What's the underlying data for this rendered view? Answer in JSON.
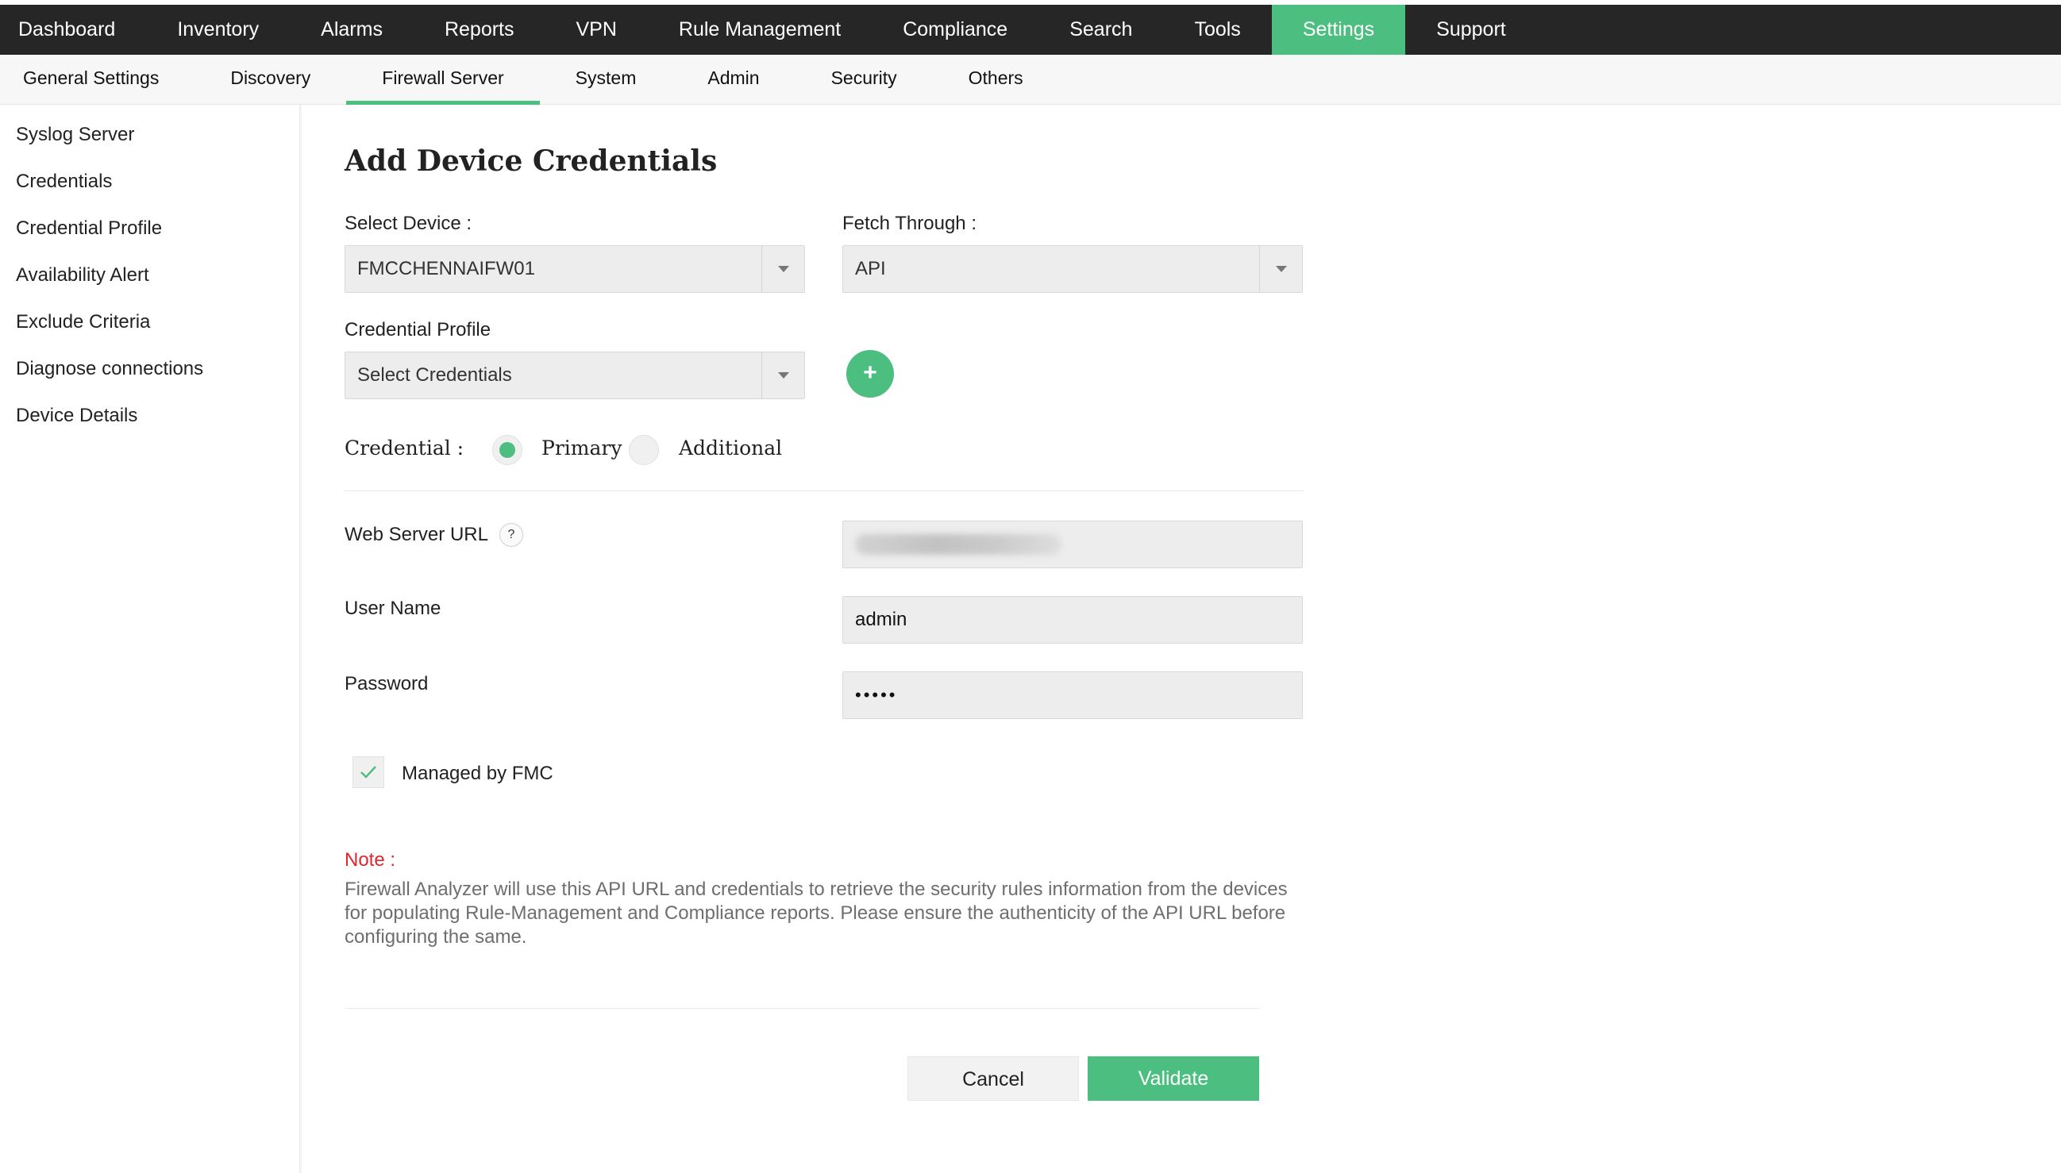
{
  "top_nav": {
    "tabs": [
      {
        "label": "Dashboard"
      },
      {
        "label": "Inventory"
      },
      {
        "label": "Alarms"
      },
      {
        "label": "Reports"
      },
      {
        "label": "VPN"
      },
      {
        "label": "Rule Management"
      },
      {
        "label": "Compliance"
      },
      {
        "label": "Search"
      },
      {
        "label": "Tools"
      },
      {
        "label": "Settings",
        "active": true
      },
      {
        "label": "Support"
      }
    ]
  },
  "sub_nav": {
    "tabs": [
      {
        "label": "General Settings"
      },
      {
        "label": "Discovery"
      },
      {
        "label": "Firewall Server",
        "active": true
      },
      {
        "label": "System"
      },
      {
        "label": "Admin"
      },
      {
        "label": "Security"
      },
      {
        "label": "Others"
      }
    ]
  },
  "sidebar": {
    "items": [
      {
        "label": "Syslog Server"
      },
      {
        "label": "Credentials"
      },
      {
        "label": "Credential Profile"
      },
      {
        "label": "Availability Alert"
      },
      {
        "label": "Exclude Criteria"
      },
      {
        "label": "Diagnose connections"
      },
      {
        "label": "Device Details"
      }
    ]
  },
  "form": {
    "title": "Add Device Credentials",
    "select_device": {
      "label": "Select Device :",
      "value": "FMCCHENNAIFW01"
    },
    "fetch_through": {
      "label": "Fetch Through :",
      "value": "API"
    },
    "credential_profile": {
      "label": "Credential Profile",
      "value": "Select Credentials",
      "add_label": "+"
    },
    "credential": {
      "label": "Credential :",
      "primary_label": "Primary",
      "additional_label": "Additional",
      "selected": "Primary"
    },
    "web_server_url": {
      "label": "Web Server URL",
      "help": "?",
      "value_redacted": true
    },
    "user_name": {
      "label": "User Name",
      "value": "admin"
    },
    "password": {
      "label": "Password",
      "value": "•••••"
    },
    "managed_by_fmc": {
      "label": "Managed by FMC",
      "checked": true
    },
    "note": {
      "label": "Note :",
      "text": "Firewall Analyzer will use this API URL and credentials to retrieve the security rules information from the devices for populating Rule-Management and Compliance reports. Please ensure the authenticity of the API URL before configuring the same."
    },
    "buttons": {
      "cancel": "Cancel",
      "validate": "Validate"
    }
  },
  "colors": {
    "accent": "#4cbf80",
    "top_nav_bg": "#262626",
    "note_red": "#e0262d"
  }
}
